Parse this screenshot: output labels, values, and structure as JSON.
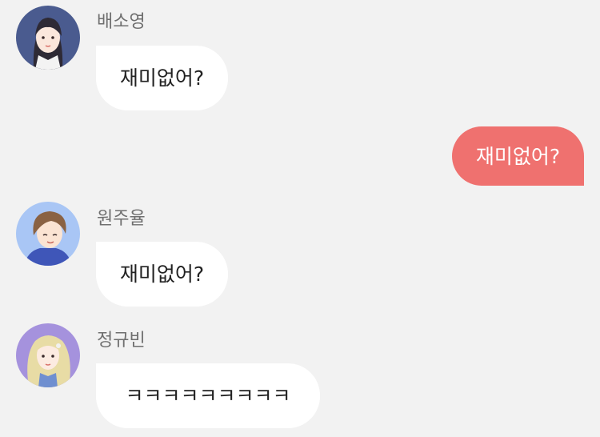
{
  "colors": {
    "background": "#f2f2f2",
    "incoming_bubble": "#ffffff",
    "outgoing_bubble": "#ef716f",
    "sender_name": "#6f6f6f"
  },
  "messages": [
    {
      "sender": "배소영",
      "avatar": "avatar-girl-dark-hair-icon",
      "text": "재미없어?",
      "direction": "incoming"
    },
    {
      "sender": "",
      "text": "재미없어?",
      "direction": "outgoing"
    },
    {
      "sender": "원주율",
      "avatar": "avatar-boy-brown-hair-icon",
      "text": "재미없어?",
      "direction": "incoming"
    },
    {
      "sender": "정규빈",
      "avatar": "avatar-girl-blonde-hair-icon",
      "text": "ㅋㅋㅋㅋㅋㅋㅋㅋㅋ",
      "direction": "incoming"
    }
  ]
}
